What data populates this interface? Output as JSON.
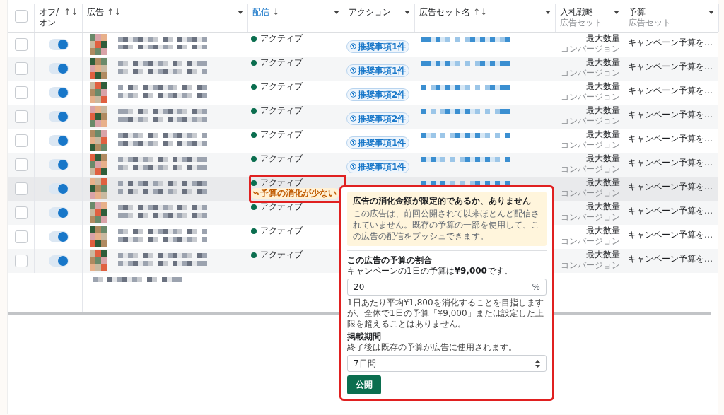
{
  "columns": [
    {
      "kind": "checkbox",
      "checked": false
    },
    {
      "kind": "toggle",
      "label": "オフ/オン",
      "sort": "↑↓"
    },
    {
      "kind": "ad",
      "label": "広告",
      "sort": "↑↓",
      "menu": true
    },
    {
      "kind": "delivery",
      "label": "配信",
      "sort": "↓",
      "menu": true,
      "active": true
    },
    {
      "kind": "action",
      "label": "アクション",
      "menu": true
    },
    {
      "kind": "adset",
      "label": "広告セット名",
      "sort": "↑↓",
      "menu": true
    },
    {
      "kind": "bid",
      "label": "入札戦略",
      "sub": "広告セット",
      "menu": true
    },
    {
      "kind": "budget",
      "label": "予算",
      "sub": "広告セット",
      "menu": true
    }
  ],
  "rows": [
    {
      "checked": false,
      "on": true,
      "highlighted": false,
      "status": "アクティブ",
      "action": "推奨事項1件",
      "bid": "最大数量",
      "bid_sub": "コンバージョン",
      "budget": "キャンペーン予算を…"
    },
    {
      "checked": false,
      "on": true,
      "highlighted": false,
      "status": "アクティブ",
      "action": "推奨事項1件",
      "bid": "最大数量",
      "bid_sub": "コンバージョン",
      "budget": "キャンペーン予算を…"
    },
    {
      "checked": false,
      "on": true,
      "highlighted": false,
      "status": "アクティブ",
      "action": "推奨事項2件",
      "bid": "最大数量",
      "bid_sub": "コンバージョン",
      "budget": "キャンペーン予算を…"
    },
    {
      "checked": false,
      "on": true,
      "highlighted": false,
      "status": "アクティブ",
      "action": "推奨事項2件",
      "bid": "最大数量",
      "bid_sub": "コンバージョン",
      "budget": "キャンペーン予算を…"
    },
    {
      "checked": false,
      "on": true,
      "highlighted": false,
      "status": "アクティブ",
      "action": "推奨事項1件",
      "bid": "最大数量",
      "bid_sub": "コンバージョン",
      "budget": "キャンペーン予算を…"
    },
    {
      "checked": false,
      "on": true,
      "highlighted": false,
      "status": "アクティブ",
      "action": "推奨事項1件",
      "bid": "最大数量",
      "bid_sub": "コンバージョン",
      "budget": "キャンペーン予算を…"
    },
    {
      "checked": false,
      "on": true,
      "highlighted": true,
      "status": "アクティブ",
      "badge": "予算の消化が少ない",
      "bid": "最大数量",
      "bid_sub": "コンバージョン",
      "budget": "キャンペーン予算を…"
    },
    {
      "checked": false,
      "on": true,
      "highlighted": false,
      "status": "アクティブ",
      "bid": "最大数量",
      "bid_sub": "コンバージョン",
      "budget": "キャンペーン予算を…"
    },
    {
      "checked": false,
      "on": true,
      "highlighted": false,
      "status": "アクティブ",
      "bid": "最大数量",
      "bid_sub": "コンバージョン",
      "budget": "キャンペーン予算を…"
    },
    {
      "checked": false,
      "on": true,
      "highlighted": false,
      "status": "アクティブ",
      "bid": "最大数量",
      "bid_sub": "コンバージョン",
      "budget": "キャンペーン予算を…"
    }
  ],
  "popover": {
    "notice_title": "広告の消化金額が限定的であるか、ありません",
    "notice_body": "この広告は、前回公開されて以来ほとんど配信されていません。既存の予算の一部を使用して、この広告の配信をプッシュできます。",
    "share_label": "この広告の予算の割合",
    "share_hint": "キャンペーンの1日の予算は**¥9,000**です。",
    "share_value": "20",
    "share_unit": "%",
    "share_note": "1日あたり平均¥1,800を消化することを目指しますが、全体で1日の予算「¥9,000」または設定した上限を超えることはありません。",
    "period_label": "掲載期間",
    "period_hint": "終了後は既存の予算が広告に使用されます。",
    "period_value": "7日間",
    "publish": "公開"
  }
}
